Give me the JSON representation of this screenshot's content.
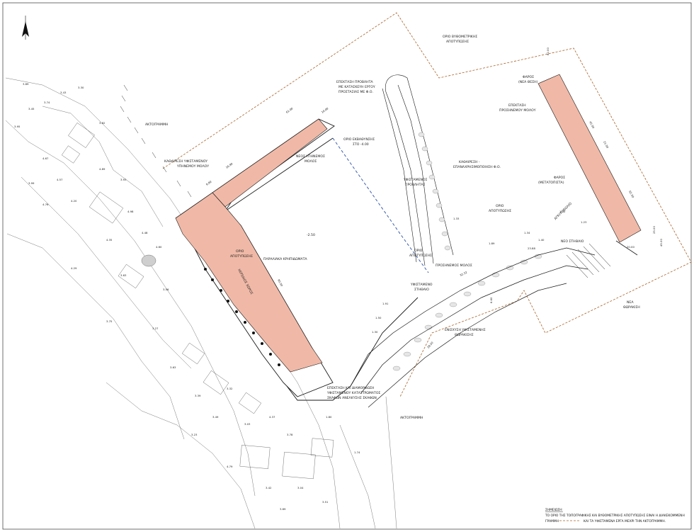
{
  "labels": {
    "coastline": "ΑΚΤΟΓΡΑΜΜΗ",
    "coastline2": "ΑΚΤΟΓΡΑΜΜΗ",
    "limit_bathy": "ΟΡΙΟ ΒΥΘΟΜΕΤΡΙΚΗΣ",
    "limit_bathy2": "ΑΠΟΤΥΠΩΣΗΣ",
    "ext_breakwater_1": "ΕΠΕΚΤΑΣΗ ΠΡΟΒΛΗΤΑ",
    "ext_breakwater_2": "ΜΕ ΚΑΤΑΣΚΕΥΗ ΕΡΓΟΥ",
    "ext_breakwater_3": "ΠΡΟΣΤΑΣΙΑΣ ΜΕ Φ.Ο.",
    "lighthouse_new_1": "ΦΑΡΟΣ",
    "lighthouse_new_2": "(ΝΕΑ ΘΕΣΗ)",
    "ext_lee_mole_1": "ΕΠΕΚΤΑΣΗ",
    "ext_lee_mole_2": "ΠΡΟΣΗΝΕΜΟΥ ΜΟΛΟΥ",
    "dredge_limit_1": "ΟΡΙΟ ΕΚΒΑΘΥΝΣΗΣ",
    "dredge_limit_2": "ΣΤΟ -4.00",
    "removal_1": "ΚΑΘΑΙΡΕΣΗ ΥΦΙΣΤΑΜΕΝΟΥ",
    "removal_2": "ΥΠΗΝΕΜΟΥ ΜΟΛΟΥ",
    "new_mole_1": "ΝΕΟΣ ΥΠΗΝΕΜΟΣ",
    "new_mole_2": "ΜΟΛΟΣ",
    "cleaning_1": "ΚΑΘΑΙΡΕΣΗ -",
    "cleaning_2": "ΕΠΑΝΑΧΡΗΣΙΜΟΠΟΙΗΣΗ Φ.Ο.",
    "existing_pier_1": "ΥΦΙΣΤΑΜΕΝΟΣ",
    "existing_pier_2": "ΠΡΟΒΛΗΤΑΣ",
    "lighthouse_moved_1": "ΦΑΡΟΣ",
    "lighthouse_moved_2": "(ΜΕΤΑΤΟΠΙΣΤΑ)",
    "limit_survey_1": "ΟΡΙΟ",
    "limit_survey_2": "ΑΠΟΤΥΠΩΣΗΣ",
    "limit_survey_a": "ΟΡΙΟ",
    "limit_survey_b": "ΑΠΟΤΥΠΩΣΗΣ",
    "depth": "-2.50",
    "quay_walls": "ΠΑΡΑΛΙΑΚΑ ΚΡΗΠΙΔΩΜΑΤΑ",
    "reclaimed": "ΧΕΡΣΑΙΟΣ ΧΩΡΟΣ",
    "limit_survey_c": "ΟΡΙΟ",
    "limit_survey_d": "ΑΠΟΤΥΠΩΣΗΣ",
    "lee_mole_label": "ΠΡΟΣΗΝΕΜΟΣ ΜΟΛΟΣ",
    "new_stairs": "ΝΕΟ ΣΤΗΘΑΙΟ",
    "existing_wall_1": "ΥΦΙΣΤΑΜΕΝΟ",
    "existing_wall_2": "ΣΤΗΘΑΙΟ",
    "ext_armour_1": "ΕΝΙΣΧΥΣΗ ΥΦΙΣΤΑΜΕΝΗΣ",
    "ext_armour_2": "ΘΩΡΑΚΙΣΗΣ",
    "new_armour_1": "ΝΕΑ",
    "new_armour_2": "ΘΩΡΑΚΙΣΗ",
    "ext_ramp_1": "ΕΠΕΚΤΑΣΗ ΚΑΙ ΔΙΑΜΟΡΦΩΣΗ",
    "ext_ramp_2": "ΥΦΙΣΤΑΜΕΝΟΥ ΚΑΤΑΣΤΡΩΜΑΤΟΣ",
    "ext_ramp_3": "ΣΚΑΦΩΝ ΑΝΕΛΚΥΣΗΣ ΣΚΑΦΩΝ",
    "anchor": "ΑΓΚΥΡΟΒΟΛΙΟ"
  },
  "dimensions": [
    "61.00",
    "10.00",
    "16.90",
    "9.80",
    "23.88",
    "62.00",
    "45.00",
    "21.00",
    "62.00",
    "25.00",
    "20.00",
    "45.00",
    "6.60",
    "90.00",
    "32.32",
    "28.00"
  ],
  "spot_heights": [
    "3.89",
    "3.74",
    "3.43",
    "3.45",
    "3.95",
    "3.30",
    "3.82",
    "4.67",
    "4.57",
    "3.99",
    "4.76",
    "4.20",
    "4.89",
    "3.93",
    "4.98",
    "4.48",
    "4.35",
    "3.63",
    "4.29",
    "4.60",
    "3.56",
    "3.75",
    "3.27",
    "3.63",
    "3.39",
    "3.32",
    "3.49",
    "3.23",
    "3.03",
    "4.37",
    "3.78",
    "4.79",
    "3.42",
    "3.04",
    "3.51",
    "3.69",
    "1.80",
    "1.74",
    "1.50",
    "1.91",
    "1.30",
    "1.40",
    "1.72",
    "1.34",
    "1.23",
    "1.89",
    "1.33"
  ],
  "notes": {
    "title": "ΣΗΜΕΙΩΣΗ:",
    "line1": "ΤΟ ΟΡΙΟ ΤΗΣ ΤΟΠΟΓΡΑΦΙΚΗΣ ΚΑΙ ΒΥΘΟΜΕΤΡΙΚΗΣ ΑΠΟΤΥΠΩΣΗΣ ΕΙΝΑΙ Η ΔΙΑΚΕΚΟΜΜΕΝΗ",
    "line2a": "ΓΡΑΜΜΗ",
    "line2b": "ΚΑΙ ΤΑ ΥΦΙΣΤΑΜΕΝΑ ΕΡΓΑ ΜΕΧΡΙ ΤΗΝ ΑΚΤΟΓΡΑΜΜΗ."
  },
  "colors": {
    "newworks": "#f0b9a7",
    "line": "#1a1a1a",
    "survey": "#a8622a",
    "dredge": "#2a4fa8"
  }
}
